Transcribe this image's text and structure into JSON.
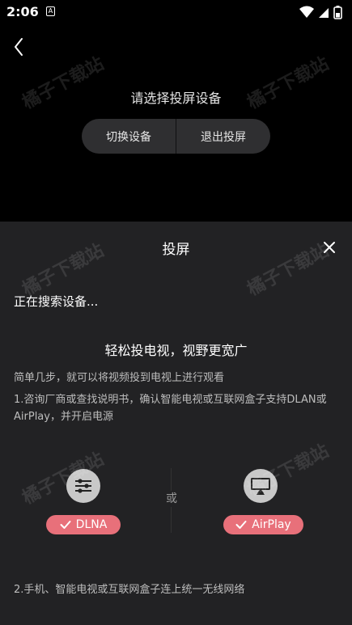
{
  "status_bar": {
    "time": "2:06",
    "notification_letter": "A"
  },
  "header": {
    "prompt": "请选择投屏设备"
  },
  "actions": {
    "switch_device": "切换设备",
    "exit_cast": "退出投屏"
  },
  "sheet": {
    "title": "投屏",
    "searching": "正在搜索设备...",
    "headline": "轻松投电视，视野更宽广",
    "description": "简单几步，就可以将视频投到电视上进行观看",
    "step1": "1.咨询厂商或查找说明书，确认智能电视或互联网盒子支持DLAN或AirPlay，并开启电源",
    "or_label": "或",
    "protocols": [
      {
        "name": "DLNA",
        "icon": "dlna-icon"
      },
      {
        "name": "AirPlay",
        "icon": "airplay-icon"
      }
    ],
    "step2": "2.手机、智能电视或互联网盒子连上统一无线网络"
  },
  "watermark": "橘子下载站",
  "colors": {
    "accent": "#e8707a",
    "sheet_bg": "#222224",
    "top_bg": "#000000",
    "pill_bg": "#2f2f31"
  }
}
